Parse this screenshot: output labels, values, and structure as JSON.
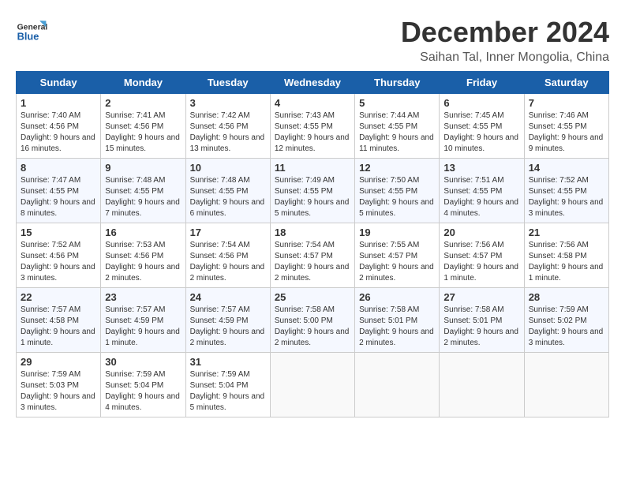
{
  "logo": {
    "general": "General",
    "blue": "Blue"
  },
  "title": "December 2024",
  "subtitle": "Saihan Tal, Inner Mongolia, China",
  "headers": [
    "Sunday",
    "Monday",
    "Tuesday",
    "Wednesday",
    "Thursday",
    "Friday",
    "Saturday"
  ],
  "weeks": [
    [
      {
        "day": "1",
        "sunrise": "7:40 AM",
        "sunset": "4:56 PM",
        "daylight": "9 hours and 16 minutes."
      },
      {
        "day": "2",
        "sunrise": "7:41 AM",
        "sunset": "4:56 PM",
        "daylight": "9 hours and 15 minutes."
      },
      {
        "day": "3",
        "sunrise": "7:42 AM",
        "sunset": "4:56 PM",
        "daylight": "9 hours and 13 minutes."
      },
      {
        "day": "4",
        "sunrise": "7:43 AM",
        "sunset": "4:55 PM",
        "daylight": "9 hours and 12 minutes."
      },
      {
        "day": "5",
        "sunrise": "7:44 AM",
        "sunset": "4:55 PM",
        "daylight": "9 hours and 11 minutes."
      },
      {
        "day": "6",
        "sunrise": "7:45 AM",
        "sunset": "4:55 PM",
        "daylight": "9 hours and 10 minutes."
      },
      {
        "day": "7",
        "sunrise": "7:46 AM",
        "sunset": "4:55 PM",
        "daylight": "9 hours and 9 minutes."
      }
    ],
    [
      {
        "day": "8",
        "sunrise": "7:47 AM",
        "sunset": "4:55 PM",
        "daylight": "9 hours and 8 minutes."
      },
      {
        "day": "9",
        "sunrise": "7:48 AM",
        "sunset": "4:55 PM",
        "daylight": "9 hours and 7 minutes."
      },
      {
        "day": "10",
        "sunrise": "7:48 AM",
        "sunset": "4:55 PM",
        "daylight": "9 hours and 6 minutes."
      },
      {
        "day": "11",
        "sunrise": "7:49 AM",
        "sunset": "4:55 PM",
        "daylight": "9 hours and 5 minutes."
      },
      {
        "day": "12",
        "sunrise": "7:50 AM",
        "sunset": "4:55 PM",
        "daylight": "9 hours and 5 minutes."
      },
      {
        "day": "13",
        "sunrise": "7:51 AM",
        "sunset": "4:55 PM",
        "daylight": "9 hours and 4 minutes."
      },
      {
        "day": "14",
        "sunrise": "7:52 AM",
        "sunset": "4:55 PM",
        "daylight": "9 hours and 3 minutes."
      }
    ],
    [
      {
        "day": "15",
        "sunrise": "7:52 AM",
        "sunset": "4:56 PM",
        "daylight": "9 hours and 3 minutes."
      },
      {
        "day": "16",
        "sunrise": "7:53 AM",
        "sunset": "4:56 PM",
        "daylight": "9 hours and 2 minutes."
      },
      {
        "day": "17",
        "sunrise": "7:54 AM",
        "sunset": "4:56 PM",
        "daylight": "9 hours and 2 minutes."
      },
      {
        "day": "18",
        "sunrise": "7:54 AM",
        "sunset": "4:57 PM",
        "daylight": "9 hours and 2 minutes."
      },
      {
        "day": "19",
        "sunrise": "7:55 AM",
        "sunset": "4:57 PM",
        "daylight": "9 hours and 2 minutes."
      },
      {
        "day": "20",
        "sunrise": "7:56 AM",
        "sunset": "4:57 PM",
        "daylight": "9 hours and 1 minute."
      },
      {
        "day": "21",
        "sunrise": "7:56 AM",
        "sunset": "4:58 PM",
        "daylight": "9 hours and 1 minute."
      }
    ],
    [
      {
        "day": "22",
        "sunrise": "7:57 AM",
        "sunset": "4:58 PM",
        "daylight": "9 hours and 1 minute."
      },
      {
        "day": "23",
        "sunrise": "7:57 AM",
        "sunset": "4:59 PM",
        "daylight": "9 hours and 1 minute."
      },
      {
        "day": "24",
        "sunrise": "7:57 AM",
        "sunset": "4:59 PM",
        "daylight": "9 hours and 2 minutes."
      },
      {
        "day": "25",
        "sunrise": "7:58 AM",
        "sunset": "5:00 PM",
        "daylight": "9 hours and 2 minutes."
      },
      {
        "day": "26",
        "sunrise": "7:58 AM",
        "sunset": "5:01 PM",
        "daylight": "9 hours and 2 minutes."
      },
      {
        "day": "27",
        "sunrise": "7:58 AM",
        "sunset": "5:01 PM",
        "daylight": "9 hours and 2 minutes."
      },
      {
        "day": "28",
        "sunrise": "7:59 AM",
        "sunset": "5:02 PM",
        "daylight": "9 hours and 3 minutes."
      }
    ],
    [
      {
        "day": "29",
        "sunrise": "7:59 AM",
        "sunset": "5:03 PM",
        "daylight": "9 hours and 3 minutes."
      },
      {
        "day": "30",
        "sunrise": "7:59 AM",
        "sunset": "5:04 PM",
        "daylight": "9 hours and 4 minutes."
      },
      {
        "day": "31",
        "sunrise": "7:59 AM",
        "sunset": "5:04 PM",
        "daylight": "9 hours and 5 minutes."
      },
      null,
      null,
      null,
      null
    ]
  ]
}
